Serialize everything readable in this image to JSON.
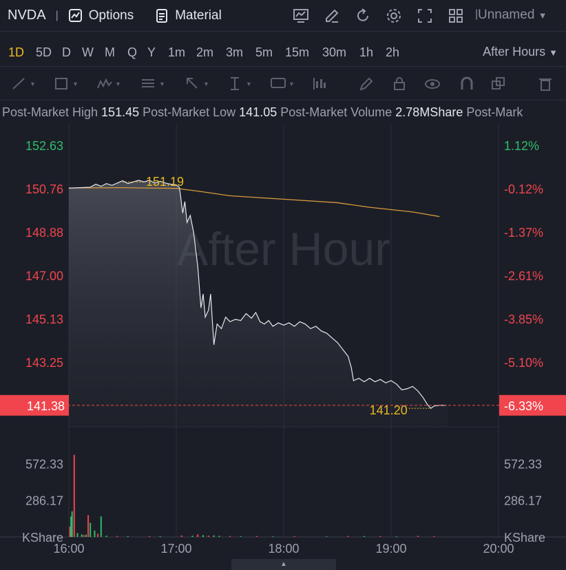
{
  "header": {
    "ticker": "NVDA",
    "options_label": "Options",
    "material_label": "Material",
    "layout_name": "Unnamed",
    "toolbar_icons": [
      "indicator-icon",
      "draw-icon",
      "refresh-icon",
      "settings-icon",
      "fullscreen-icon",
      "layout-grid-icon"
    ]
  },
  "timeframes": [
    "1D",
    "5D",
    "D",
    "W",
    "M",
    "Q",
    "Y",
    "1m",
    "2m",
    "3m",
    "5m",
    "15m",
    "30m",
    "1h",
    "2h"
  ],
  "active_timeframe": "1D",
  "session_label": "After Hours",
  "drawing_tools": [
    "trend-line-icon",
    "rectangle-icon",
    "pattern-icon",
    "fib-icon",
    "arrow-icon",
    "measure-icon",
    "text-note-icon",
    "position-icon",
    "pen-icon",
    "lock-icon",
    "visibility-icon",
    "magnet-icon",
    "clone-icon",
    "trash-icon"
  ],
  "stats": [
    {
      "label": "Post-Market High",
      "value": "151.45"
    },
    {
      "label": "Post-Market Low",
      "value": "141.05"
    },
    {
      "label": "Post-Market Volume",
      "value": "2.78MShare"
    },
    {
      "label": "Post-Mark",
      "value": ""
    }
  ],
  "colors": {
    "up": "#2fbd6b",
    "down": "#f0454d",
    "price_line": "#e6e8ec",
    "avg_line": "#d99a3c",
    "highlight": "#e8b923",
    "bg": "#1b1e27"
  },
  "chart_data": {
    "type": "line",
    "watermark": "After Hour",
    "y_ticks": [
      "152.63",
      "150.76",
      "148.88",
      "147.00",
      "145.13",
      "143.25"
    ],
    "pct_ticks": [
      "1.12%",
      "-0.12%",
      "-1.37%",
      "-2.61%",
      "-3.85%",
      "-5.10%"
    ],
    "x_ticks": [
      "16:00",
      "17:00",
      "18:00",
      "19:00",
      "20:00"
    ],
    "current_price": "141.38",
    "current_pct": "-6.33%",
    "high_marker": "151.19",
    "low_marker": "141.20",
    "volume_ticks": [
      "572.33",
      "286.17",
      "KShare"
    ],
    "ylim": [
      140.45,
      153.56
    ],
    "xlim_hours": [
      16,
      20
    ],
    "price_series": [
      [
        16.0,
        150.78
      ],
      [
        16.1,
        150.8
      ],
      [
        16.2,
        150.82
      ],
      [
        16.25,
        150.95
      ],
      [
        16.3,
        150.86
      ],
      [
        16.35,
        150.98
      ],
      [
        16.4,
        150.9
      ],
      [
        16.45,
        151.0
      ],
      [
        16.5,
        151.1
      ],
      [
        16.55,
        150.98
      ],
      [
        16.6,
        151.05
      ],
      [
        16.65,
        151.12
      ],
      [
        16.7,
        151.05
      ],
      [
        16.75,
        151.12
      ],
      [
        16.8,
        151.0
      ],
      [
        16.85,
        151.08
      ],
      [
        16.9,
        151.0
      ],
      [
        16.95,
        150.95
      ],
      [
        17.0,
        150.92
      ],
      [
        17.03,
        150.8
      ],
      [
        17.06,
        149.7
      ],
      [
        17.08,
        150.2
      ],
      [
        17.1,
        149.3
      ],
      [
        17.13,
        149.6
      ],
      [
        17.16,
        148.9
      ],
      [
        17.2,
        147.4
      ],
      [
        17.23,
        145.6
      ],
      [
        17.25,
        146.2
      ],
      [
        17.27,
        145.2
      ],
      [
        17.3,
        145.5
      ],
      [
        17.32,
        146.2
      ],
      [
        17.35,
        144.0
      ],
      [
        17.38,
        144.9
      ],
      [
        17.42,
        144.7
      ],
      [
        17.46,
        145.2
      ],
      [
        17.5,
        145.0
      ],
      [
        17.55,
        145.1
      ],
      [
        17.6,
        145.05
      ],
      [
        17.65,
        145.35
      ],
      [
        17.7,
        145.15
      ],
      [
        17.74,
        145.4
      ],
      [
        17.78,
        145.0
      ],
      [
        17.82,
        144.9
      ],
      [
        17.86,
        145.05
      ],
      [
        17.9,
        144.8
      ],
      [
        17.95,
        144.95
      ],
      [
        18.0,
        144.85
      ],
      [
        18.05,
        144.95
      ],
      [
        18.1,
        144.8
      ],
      [
        18.15,
        145.0
      ],
      [
        18.2,
        144.9
      ],
      [
        18.25,
        144.7
      ],
      [
        18.3,
        144.8
      ],
      [
        18.35,
        144.6
      ],
      [
        18.4,
        144.5
      ],
      [
        18.45,
        144.3
      ],
      [
        18.5,
        144.1
      ],
      [
        18.55,
        143.8
      ],
      [
        18.6,
        143.5
      ],
      [
        18.63,
        143.0
      ],
      [
        18.65,
        142.45
      ],
      [
        18.7,
        142.55
      ],
      [
        18.75,
        142.4
      ],
      [
        18.8,
        142.55
      ],
      [
        18.85,
        142.4
      ],
      [
        18.9,
        142.5
      ],
      [
        18.95,
        142.35
      ],
      [
        19.0,
        142.45
      ],
      [
        19.05,
        142.3
      ],
      [
        19.1,
        142.05
      ],
      [
        19.15,
        142.1
      ],
      [
        19.2,
        142.2
      ],
      [
        19.25,
        142.0
      ],
      [
        19.3,
        141.7
      ],
      [
        19.34,
        141.4
      ],
      [
        19.37,
        141.25
      ],
      [
        19.4,
        141.35
      ],
      [
        19.45,
        141.38
      ]
    ],
    "avg_series": [
      [
        16.0,
        150.79
      ],
      [
        16.5,
        150.8
      ],
      [
        17.0,
        150.77
      ],
      [
        17.2,
        150.65
      ],
      [
        17.5,
        150.45
      ],
      [
        18.0,
        150.3
      ],
      [
        18.5,
        150.15
      ],
      [
        18.8,
        149.95
      ],
      [
        19.2,
        149.75
      ],
      [
        19.45,
        149.55
      ]
    ],
    "volume_bars": [
      {
        "t": 16.01,
        "v": 80,
        "c": "down"
      },
      {
        "t": 16.02,
        "v": 160,
        "c": "up"
      },
      {
        "t": 16.03,
        "v": 200,
        "c": "up"
      },
      {
        "t": 16.05,
        "v": 640,
        "c": "down"
      },
      {
        "t": 16.08,
        "v": 30,
        "c": "up"
      },
      {
        "t": 16.12,
        "v": 20,
        "c": "up"
      },
      {
        "t": 16.14,
        "v": 15,
        "c": "down"
      },
      {
        "t": 16.16,
        "v": 18,
        "c": "up"
      },
      {
        "t": 16.18,
        "v": 170,
        "c": "down"
      },
      {
        "t": 16.2,
        "v": 110,
        "c": "up"
      },
      {
        "t": 16.24,
        "v": 50,
        "c": "up"
      },
      {
        "t": 16.27,
        "v": 25,
        "c": "down"
      },
      {
        "t": 16.3,
        "v": 160,
        "c": "up"
      },
      {
        "t": 16.35,
        "v": 10,
        "c": "up"
      },
      {
        "t": 16.45,
        "v": 8,
        "c": "down"
      },
      {
        "t": 16.55,
        "v": 6,
        "c": "up"
      },
      {
        "t": 16.75,
        "v": 7,
        "c": "down"
      },
      {
        "t": 16.85,
        "v": 6,
        "c": "up"
      },
      {
        "t": 17.05,
        "v": 12,
        "c": "down"
      },
      {
        "t": 17.15,
        "v": 10,
        "c": "up"
      },
      {
        "t": 17.2,
        "v": 20,
        "c": "down"
      },
      {
        "t": 17.25,
        "v": 14,
        "c": "up"
      },
      {
        "t": 17.3,
        "v": 10,
        "c": "down"
      },
      {
        "t": 17.35,
        "v": 12,
        "c": "up"
      },
      {
        "t": 17.4,
        "v": 9,
        "c": "up"
      },
      {
        "t": 17.5,
        "v": 8,
        "c": "down"
      },
      {
        "t": 17.6,
        "v": 6,
        "c": "up"
      },
      {
        "t": 17.75,
        "v": 7,
        "c": "down"
      },
      {
        "t": 17.9,
        "v": 5,
        "c": "up"
      },
      {
        "t": 18.1,
        "v": 6,
        "c": "down"
      },
      {
        "t": 18.4,
        "v": 5,
        "c": "up"
      },
      {
        "t": 18.6,
        "v": 8,
        "c": "down"
      },
      {
        "t": 18.75,
        "v": 7,
        "c": "up"
      },
      {
        "t": 18.9,
        "v": 6,
        "c": "down"
      },
      {
        "t": 19.05,
        "v": 5,
        "c": "up"
      },
      {
        "t": 19.25,
        "v": 9,
        "c": "down"
      },
      {
        "t": 19.4,
        "v": 7,
        "c": "down"
      }
    ]
  }
}
